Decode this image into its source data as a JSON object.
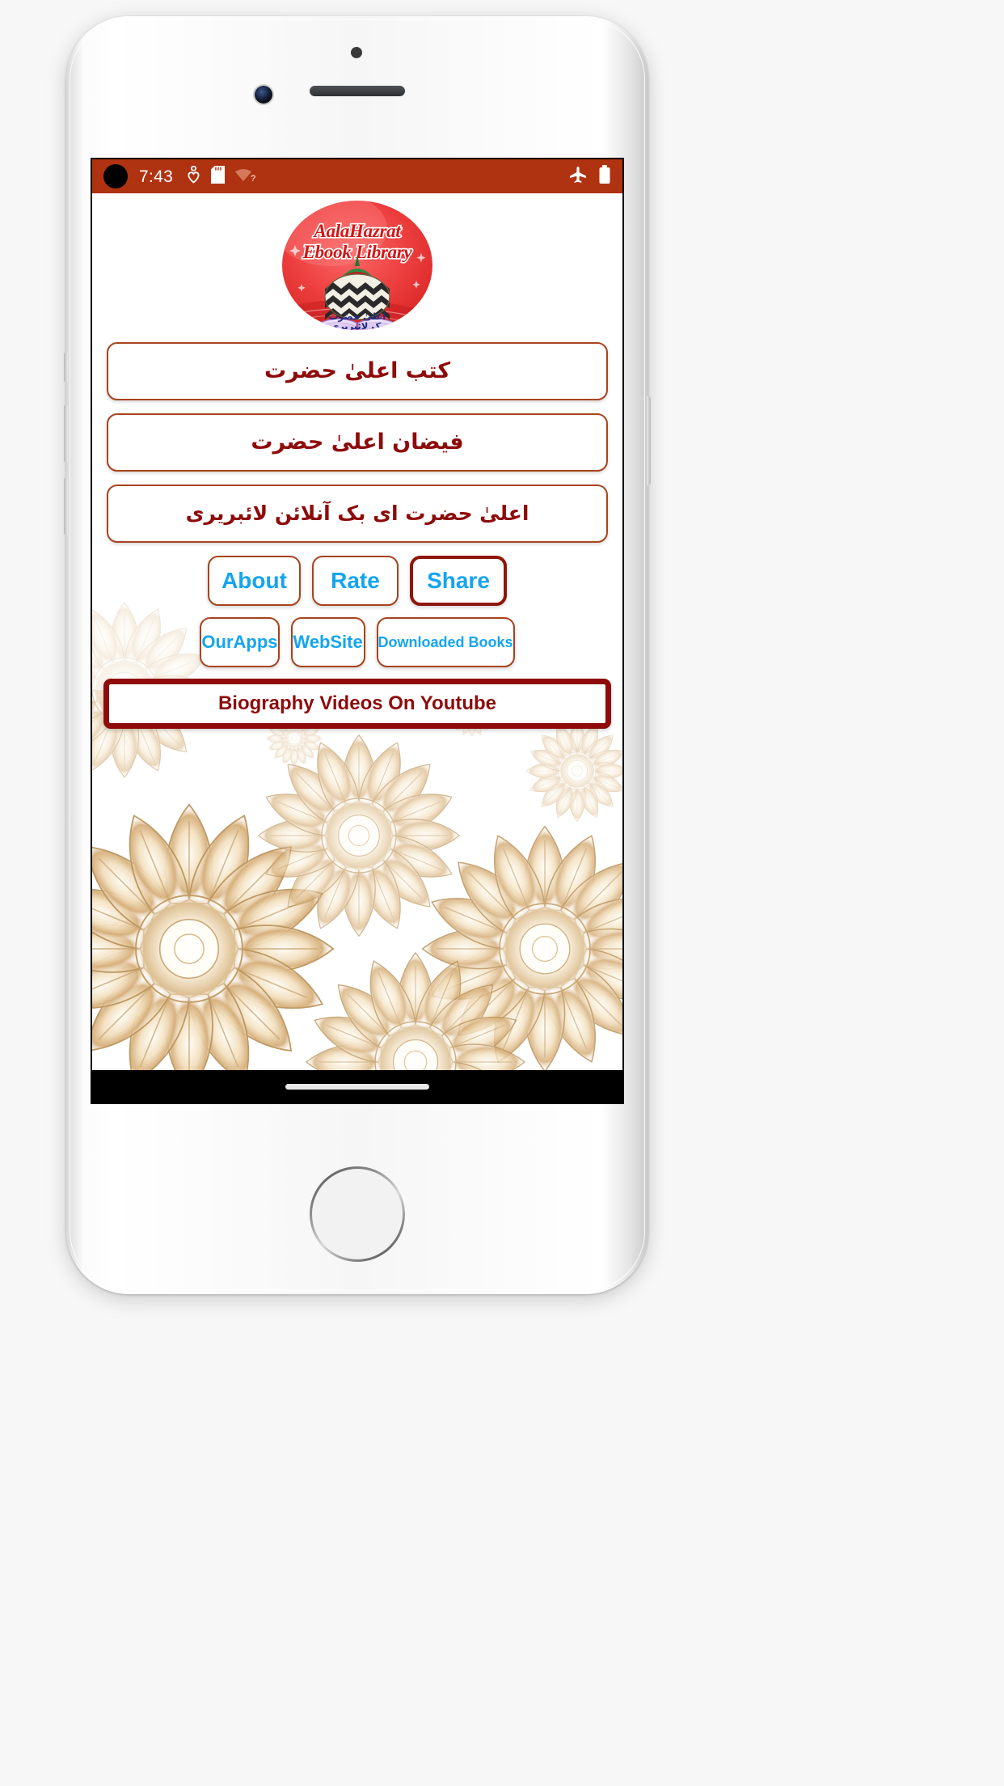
{
  "device": {
    "hardware": {
      "earpiece": "earpiece-speaker",
      "front_camera": "front-camera",
      "proximity_sensor": "proximity-sensor",
      "home_button": "home-button",
      "volume_up": "volume-up-button",
      "volume_down": "volume-down-button",
      "silent_switch": "silent-switch",
      "power": "power-button"
    }
  },
  "status_bar": {
    "time": "7:43",
    "background_color": "#b03311",
    "text_color": "#ffffff",
    "left_icons": [
      "heart-health-icon",
      "sd-card-icon",
      "wifi-unknown-icon"
    ],
    "right_icons": [
      "airplane-mode-icon",
      "battery-icon"
    ]
  },
  "app": {
    "logo": {
      "name": "aalahazrat-ebook-library-logo",
      "title_line1": "AalaHazrat",
      "title_line2": "Ebook Library",
      "urdu_caption_line1": "اعلیٰ حضرت",
      "urdu_caption_line2": "بک لائبریری",
      "background_color": "#ec4848",
      "text_color": "#c1121f"
    },
    "main_buttons": [
      {
        "id": "kutub-aala-hazrat",
        "label": "کتب اعلیٰ حضرت"
      },
      {
        "id": "faizan-aala-hazrat",
        "label": "فیضان اعلیٰ حضرت"
      },
      {
        "id": "aala-hazrat-ebook-online-library",
        "label": "اعلیٰ حضرت ای بک آنلائن لائبریری"
      }
    ],
    "action_row_1": [
      {
        "id": "about",
        "label": "About"
      },
      {
        "id": "rate",
        "label": "Rate"
      },
      {
        "id": "share",
        "label": "Share"
      }
    ],
    "action_row_2": [
      {
        "id": "ourapps",
        "label": "OurApps"
      },
      {
        "id": "website",
        "label": "WebSite"
      },
      {
        "id": "downloaded-books",
        "label": "Downloaded Books"
      }
    ],
    "banner_button": {
      "id": "biography-videos-youtube",
      "label": "Biography Videos On Youtube"
    },
    "colors": {
      "button_border": "#a8431d",
      "button_border_strong": "#8f1508",
      "urdu_text": "#8e0b0b",
      "action_text": "#14a5f0",
      "banner_text": "#8e0b0b",
      "background": "#ffffff",
      "ornament_gold": "#c9a063"
    },
    "background_decoration": "golden-mandala-ornament"
  },
  "nav_bar": {
    "gesture_pill": "home-gesture-pill",
    "background_color": "#000000"
  }
}
